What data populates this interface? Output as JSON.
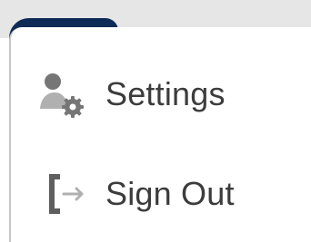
{
  "menu": {
    "items": [
      {
        "label": "Settings",
        "icon": "user-settings-icon"
      },
      {
        "label": "Sign Out",
        "icon": "sign-out-icon"
      }
    ]
  },
  "colors": {
    "accent": "#0e2a57",
    "text": "#3c3c3c",
    "icon": "#767676",
    "icon_light": "#b0b0b0",
    "topbar": "#e6e6e6"
  }
}
